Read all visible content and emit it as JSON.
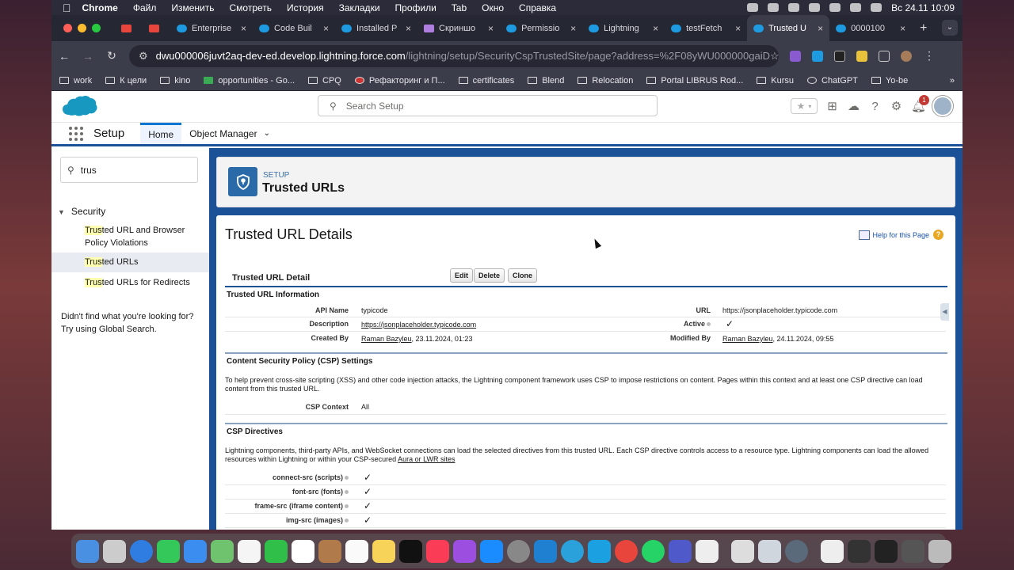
{
  "menubar": {
    "app": "Chrome",
    "items": [
      "Файл",
      "Изменить",
      "Смотреть",
      "История",
      "Закладки",
      "Профили",
      "Tab",
      "Окно",
      "Справка"
    ],
    "datetime": "Вс 24.11  10:09"
  },
  "tabs": [
    {
      "label": "",
      "icon": "gmail-icon"
    },
    {
      "label": "",
      "icon": "gmail-icon"
    },
    {
      "label": "Enterprise",
      "icon": "salesforce-icon"
    },
    {
      "label": "Code Buil",
      "icon": "salesforce-icon"
    },
    {
      "label": "Installed P",
      "icon": "salesforce-icon"
    },
    {
      "label": "Скриншо",
      "icon": "pen-icon"
    },
    {
      "label": "Permissio",
      "icon": "salesforce-icon"
    },
    {
      "label": "Lightning",
      "icon": "salesforce-icon"
    },
    {
      "label": "testFetch",
      "icon": "salesforce-icon"
    },
    {
      "label": "Trusted U",
      "icon": "salesforce-icon",
      "active": true
    },
    {
      "label": "0000100",
      "icon": "salesforce-icon"
    }
  ],
  "address": {
    "host": "dwu000006juvt2aq-dev-ed.develop.lightning.force.com",
    "path": "/lightning/setup/SecurityCspTrustedSite/page?address=%2F08yWU000000gaiD"
  },
  "bookmarks": [
    "work",
    "К цели",
    "kino",
    "opportunities - Go...",
    "CPQ",
    "Рефакторинг и П...",
    "certificates",
    "Blend",
    "Relocation",
    "Portal LIBRUS Rod...",
    "Kursu",
    "ChatGPT",
    "Yo-be"
  ],
  "sf": {
    "search_placeholder": "Search Setup",
    "app_title": "Setup",
    "nav_home": "Home",
    "nav_object_manager": "Object Manager",
    "notification_count": "1"
  },
  "sidebar": {
    "quickfind": "trus",
    "section": "Security",
    "items": [
      {
        "hl": "Trus",
        "rest": "ted URL and Browser Policy Violations"
      },
      {
        "hl": "Trus",
        "rest": "ted URLs"
      },
      {
        "hl": "Trus",
        "rest": "ted URLs for Redirects"
      }
    ],
    "not_found": "Didn't find what you're looking for? Try using Global Search."
  },
  "header": {
    "setup": "SETUP",
    "title": "Trusted URLs"
  },
  "page": {
    "title": "Trusted URL Details",
    "help": "Help for this Page",
    "detail_title": "Trusted URL Detail",
    "buttons": {
      "edit": "Edit",
      "delete": "Delete",
      "clone": "Clone"
    }
  },
  "info": {
    "heading": "Trusted URL Information",
    "api_name_label": "API Name",
    "api_name": "typicode",
    "url_label": "URL",
    "url": "https://jsonplaceholder.typicode.com",
    "description_label": "Description",
    "description": "https://jsonplaceholder.typicode.com",
    "active_label": "Active",
    "active": "✓",
    "created_by_label": "Created By",
    "created_by_name": "Raman Bazyleu",
    "created_by_date": ", 23.11.2024, 01:23",
    "modified_by_label": "Modified By",
    "modified_by_name": "Raman Bazyleu",
    "modified_by_date": ", 24.11.2024, 09:55"
  },
  "csp": {
    "heading": "Content Security Policy (CSP) Settings",
    "text": "To help prevent cross-site scripting (XSS) and other code injection attacks, the Lightning component framework uses CSP to impose restrictions on content. Pages within this context and at least one CSP directive can load content from this trusted URL.",
    "context_label": "CSP Context",
    "context": "All"
  },
  "directives": {
    "heading": "CSP Directives",
    "text_a": "Lightning components, third-party APIs, and WebSocket connections can load the selected directives from this trusted URL. Each CSP directive controls access to a resource type. Lightning components can load the allowed resources within Lightning or within your CSP-secured ",
    "link": "Aura or LWR sites",
    "rows": [
      {
        "label": "connect-src (scripts)",
        "value": "✓"
      },
      {
        "label": "font-src (fonts)",
        "value": "✓"
      },
      {
        "label": "frame-src (iframe content)",
        "value": "✓"
      },
      {
        "label": "img-src (images)",
        "value": "✓"
      }
    ]
  },
  "colors": {
    "salesforce_blue": "#0176d3",
    "page_band": "#1b5297",
    "highlight": "#ffffae"
  }
}
